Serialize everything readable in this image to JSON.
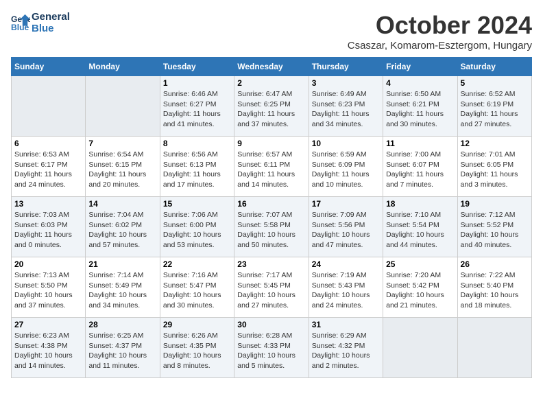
{
  "header": {
    "logo_line1": "General",
    "logo_line2": "Blue",
    "month": "October 2024",
    "location": "Csaszar, Komarom-Esztergom, Hungary"
  },
  "weekdays": [
    "Sunday",
    "Monday",
    "Tuesday",
    "Wednesday",
    "Thursday",
    "Friday",
    "Saturday"
  ],
  "weeks": [
    [
      {
        "day": "",
        "info": ""
      },
      {
        "day": "",
        "info": ""
      },
      {
        "day": "1",
        "info": "Sunrise: 6:46 AM\nSunset: 6:27 PM\nDaylight: 11 hours and 41 minutes."
      },
      {
        "day": "2",
        "info": "Sunrise: 6:47 AM\nSunset: 6:25 PM\nDaylight: 11 hours and 37 minutes."
      },
      {
        "day": "3",
        "info": "Sunrise: 6:49 AM\nSunset: 6:23 PM\nDaylight: 11 hours and 34 minutes."
      },
      {
        "day": "4",
        "info": "Sunrise: 6:50 AM\nSunset: 6:21 PM\nDaylight: 11 hours and 30 minutes."
      },
      {
        "day": "5",
        "info": "Sunrise: 6:52 AM\nSunset: 6:19 PM\nDaylight: 11 hours and 27 minutes."
      }
    ],
    [
      {
        "day": "6",
        "info": "Sunrise: 6:53 AM\nSunset: 6:17 PM\nDaylight: 11 hours and 24 minutes."
      },
      {
        "day": "7",
        "info": "Sunrise: 6:54 AM\nSunset: 6:15 PM\nDaylight: 11 hours and 20 minutes."
      },
      {
        "day": "8",
        "info": "Sunrise: 6:56 AM\nSunset: 6:13 PM\nDaylight: 11 hours and 17 minutes."
      },
      {
        "day": "9",
        "info": "Sunrise: 6:57 AM\nSunset: 6:11 PM\nDaylight: 11 hours and 14 minutes."
      },
      {
        "day": "10",
        "info": "Sunrise: 6:59 AM\nSunset: 6:09 PM\nDaylight: 11 hours and 10 minutes."
      },
      {
        "day": "11",
        "info": "Sunrise: 7:00 AM\nSunset: 6:07 PM\nDaylight: 11 hours and 7 minutes."
      },
      {
        "day": "12",
        "info": "Sunrise: 7:01 AM\nSunset: 6:05 PM\nDaylight: 11 hours and 3 minutes."
      }
    ],
    [
      {
        "day": "13",
        "info": "Sunrise: 7:03 AM\nSunset: 6:03 PM\nDaylight: 11 hours and 0 minutes."
      },
      {
        "day": "14",
        "info": "Sunrise: 7:04 AM\nSunset: 6:02 PM\nDaylight: 10 hours and 57 minutes."
      },
      {
        "day": "15",
        "info": "Sunrise: 7:06 AM\nSunset: 6:00 PM\nDaylight: 10 hours and 53 minutes."
      },
      {
        "day": "16",
        "info": "Sunrise: 7:07 AM\nSunset: 5:58 PM\nDaylight: 10 hours and 50 minutes."
      },
      {
        "day": "17",
        "info": "Sunrise: 7:09 AM\nSunset: 5:56 PM\nDaylight: 10 hours and 47 minutes."
      },
      {
        "day": "18",
        "info": "Sunrise: 7:10 AM\nSunset: 5:54 PM\nDaylight: 10 hours and 44 minutes."
      },
      {
        "day": "19",
        "info": "Sunrise: 7:12 AM\nSunset: 5:52 PM\nDaylight: 10 hours and 40 minutes."
      }
    ],
    [
      {
        "day": "20",
        "info": "Sunrise: 7:13 AM\nSunset: 5:50 PM\nDaylight: 10 hours and 37 minutes."
      },
      {
        "day": "21",
        "info": "Sunrise: 7:14 AM\nSunset: 5:49 PM\nDaylight: 10 hours and 34 minutes."
      },
      {
        "day": "22",
        "info": "Sunrise: 7:16 AM\nSunset: 5:47 PM\nDaylight: 10 hours and 30 minutes."
      },
      {
        "day": "23",
        "info": "Sunrise: 7:17 AM\nSunset: 5:45 PM\nDaylight: 10 hours and 27 minutes."
      },
      {
        "day": "24",
        "info": "Sunrise: 7:19 AM\nSunset: 5:43 PM\nDaylight: 10 hours and 24 minutes."
      },
      {
        "day": "25",
        "info": "Sunrise: 7:20 AM\nSunset: 5:42 PM\nDaylight: 10 hours and 21 minutes."
      },
      {
        "day": "26",
        "info": "Sunrise: 7:22 AM\nSunset: 5:40 PM\nDaylight: 10 hours and 18 minutes."
      }
    ],
    [
      {
        "day": "27",
        "info": "Sunrise: 6:23 AM\nSunset: 4:38 PM\nDaylight: 10 hours and 14 minutes."
      },
      {
        "day": "28",
        "info": "Sunrise: 6:25 AM\nSunset: 4:37 PM\nDaylight: 10 hours and 11 minutes."
      },
      {
        "day": "29",
        "info": "Sunrise: 6:26 AM\nSunset: 4:35 PM\nDaylight: 10 hours and 8 minutes."
      },
      {
        "day": "30",
        "info": "Sunrise: 6:28 AM\nSunset: 4:33 PM\nDaylight: 10 hours and 5 minutes."
      },
      {
        "day": "31",
        "info": "Sunrise: 6:29 AM\nSunset: 4:32 PM\nDaylight: 10 hours and 2 minutes."
      },
      {
        "day": "",
        "info": ""
      },
      {
        "day": "",
        "info": ""
      }
    ]
  ]
}
